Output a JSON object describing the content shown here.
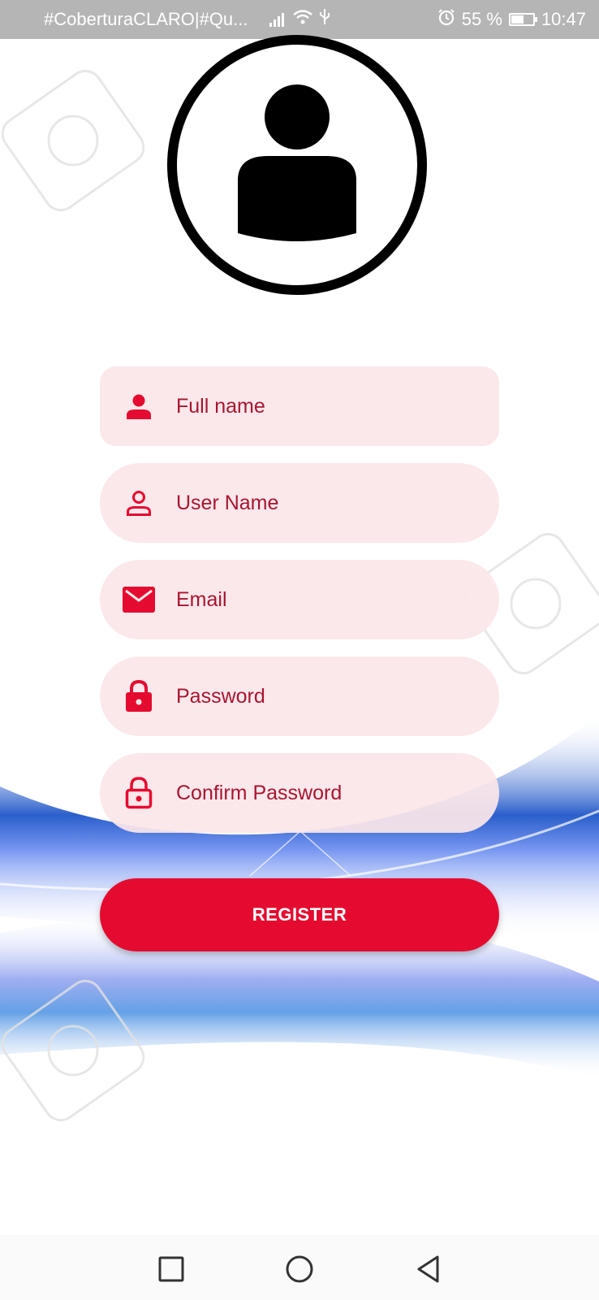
{
  "status_bar": {
    "carrier": "#CoberturaCLARO|#Qu...",
    "battery_percent": "55 %",
    "time": "10:47",
    "icons": [
      "signal-icon",
      "wifi-icon",
      "usb-icon",
      "alarm-icon",
      "battery-icon"
    ]
  },
  "form": {
    "full_name_placeholder": "Full name",
    "user_name_placeholder": "User Name",
    "email_placeholder": "Email",
    "password_placeholder": "Password",
    "confirm_password_placeholder": "Confirm Password",
    "register_label": "REGISTER"
  },
  "nav": {
    "icons": [
      "recents-square-icon",
      "home-circle-icon",
      "back-triangle-icon"
    ]
  },
  "colors": {
    "accent": "#e50b30",
    "field_bg": "#fbe6e9",
    "field_text": "#a81531"
  }
}
